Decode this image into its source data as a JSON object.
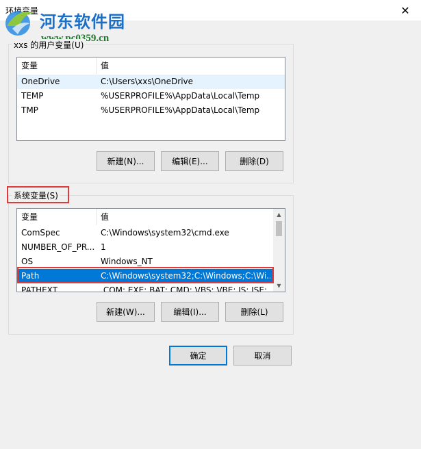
{
  "window": {
    "title": "环境变量",
    "close_glyph": "✕"
  },
  "watermark": {
    "site_name": "河东软件园",
    "url": "www.pc0359.cn"
  },
  "user_vars": {
    "legend": "xxs 的用户变量(U)",
    "columns": [
      "变量",
      "值"
    ],
    "rows": [
      {
        "name": "OneDrive",
        "value": "C:\\Users\\xxs\\OneDrive"
      },
      {
        "name": "TEMP",
        "value": "%USERPROFILE%\\AppData\\Local\\Temp"
      },
      {
        "name": "TMP",
        "value": "%USERPROFILE%\\AppData\\Local\\Temp"
      }
    ],
    "buttons": {
      "new": "新建(N)...",
      "edit": "编辑(E)...",
      "delete": "删除(D)"
    }
  },
  "system_vars": {
    "legend": "系统变量(S)",
    "columns": [
      "变量",
      "值"
    ],
    "rows": [
      {
        "name": "ComSpec",
        "value": "C:\\Windows\\system32\\cmd.exe"
      },
      {
        "name": "NUMBER_OF_PR...",
        "value": "1"
      },
      {
        "name": "OS",
        "value": "Windows_NT"
      },
      {
        "name": "Path",
        "value": "C:\\Windows\\system32;C:\\Windows;C:\\Wi..."
      },
      {
        "name": "PATHEXT",
        "value": ".COM;.EXE;.BAT;.CMD;.VBS;.VBE;.JS;.JSE;..."
      }
    ],
    "selected_row": "Path",
    "buttons": {
      "new": "新建(W)...",
      "edit": "编辑(I)...",
      "delete": "删除(L)"
    }
  },
  "dialog_buttons": {
    "ok": "确定",
    "cancel": "取消"
  },
  "colors": {
    "selection": "#0078d7",
    "highlight_box": "#e03a3a",
    "default_button_border": "#0078d7"
  },
  "icons": {
    "close": "close-icon",
    "scroll_up": "scroll-up-arrow-icon",
    "scroll_down": "scroll-down-arrow-icon"
  }
}
